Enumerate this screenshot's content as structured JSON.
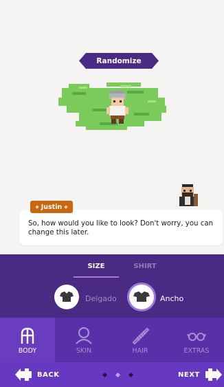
{
  "scene": {
    "randomize_label": "Randomize"
  },
  "dialog": {
    "speaker": "Justin",
    "text": "So, how would you like to look? Don't worry, you can change this later."
  },
  "editor": {
    "subtabs": [
      {
        "label": "SIZE",
        "active": true
      },
      {
        "label": "SHIRT",
        "active": false
      }
    ],
    "options": [
      {
        "label": "Delgado",
        "selected": false,
        "icon": "shirt-icon"
      },
      {
        "label": "Ancho",
        "selected": true,
        "icon": "shirt-icon"
      }
    ]
  },
  "categories": [
    {
      "label": "BODY",
      "icon": "body-icon",
      "active": true
    },
    {
      "label": "SKIN",
      "icon": "skin-icon",
      "active": false
    },
    {
      "label": "HAIR",
      "icon": "hair-comb-icon",
      "active": false
    },
    {
      "label": "EXTRAS",
      "icon": "glasses-icon",
      "active": false
    }
  ],
  "nav": {
    "back_label": "BACK",
    "next_label": "NEXT",
    "page_dots": 3,
    "current_page": 2
  },
  "colors": {
    "panel": "#4b2a84",
    "tabs": "#5a30a8",
    "bottombar": "#6738c2",
    "nametag": "#c6680f"
  }
}
